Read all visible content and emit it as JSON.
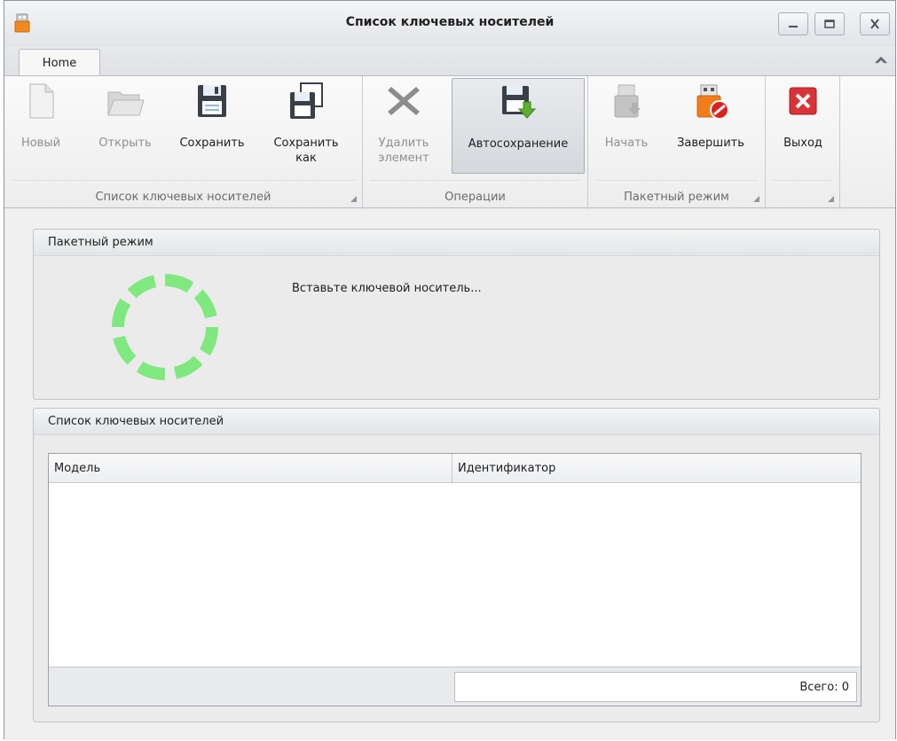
{
  "window": {
    "title": "Список ключевых носителей",
    "icon": "usb-key-icon"
  },
  "tabs": [
    {
      "label": "Home",
      "active": true
    }
  ],
  "ribbon": {
    "groups": [
      {
        "caption": "Список ключевых носителей",
        "buttons": [
          {
            "label": "Новый",
            "icon": "new-document-icon",
            "enabled": false
          },
          {
            "label": "Открыть",
            "icon": "open-folder-icon",
            "enabled": false
          },
          {
            "label": "Сохранить",
            "icon": "save-floppy-icon",
            "enabled": true
          },
          {
            "label_line1": "Сохранить",
            "label_line2": "как",
            "icon": "save-as-icon",
            "enabled": true
          }
        ]
      },
      {
        "caption": "Операции",
        "buttons": [
          {
            "label_line1": "Удалить",
            "label_line2": "элемент",
            "icon": "delete-x-icon",
            "enabled": false
          },
          {
            "label": "Автосохранение",
            "icon": "autosave-icon",
            "enabled": true,
            "pressed": true
          }
        ]
      },
      {
        "caption": "Пакетный режим",
        "buttons": [
          {
            "label": "Начать",
            "icon": "usb-start-icon",
            "enabled": false
          },
          {
            "label": "Завершить",
            "icon": "usb-stop-icon",
            "enabled": true
          }
        ]
      },
      {
        "caption": "",
        "buttons": [
          {
            "label": "Выход",
            "icon": "exit-icon",
            "enabled": true
          }
        ]
      }
    ]
  },
  "batch_panel": {
    "title": "Пакетный режим",
    "status": "Вставьте ключевой носитель..."
  },
  "list_panel": {
    "title": "Список ключевых носителей",
    "columns": [
      "Модель",
      "Идентификатор"
    ],
    "rows": [],
    "footer_total": "Всего: 0"
  },
  "colors": {
    "spinner": "#7fe87f",
    "exit_red": "#d9333a",
    "stop_orange": "#f07d1a"
  }
}
